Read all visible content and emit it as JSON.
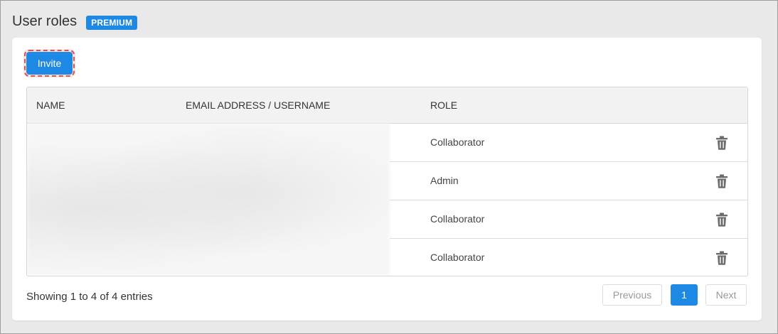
{
  "header": {
    "title": "User roles",
    "badge": "PREMIUM"
  },
  "toolbar": {
    "invite_label": "Invite"
  },
  "table": {
    "columns": [
      "NAME",
      "EMAIL ADDRESS / USERNAME",
      "ROLE"
    ],
    "rows": [
      {
        "role": "Collaborator"
      },
      {
        "role": "Admin"
      },
      {
        "role": "Collaborator"
      },
      {
        "role": "Collaborator"
      }
    ]
  },
  "footer": {
    "info": "Showing 1 to 4 of 4 entries",
    "pagination": {
      "previous": "Previous",
      "current_page": "1",
      "next": "Next"
    }
  },
  "colors": {
    "accent": "#1e88e5",
    "highlight_outline": "#d9534f"
  },
  "icons": {
    "row_action": "trash-icon"
  }
}
